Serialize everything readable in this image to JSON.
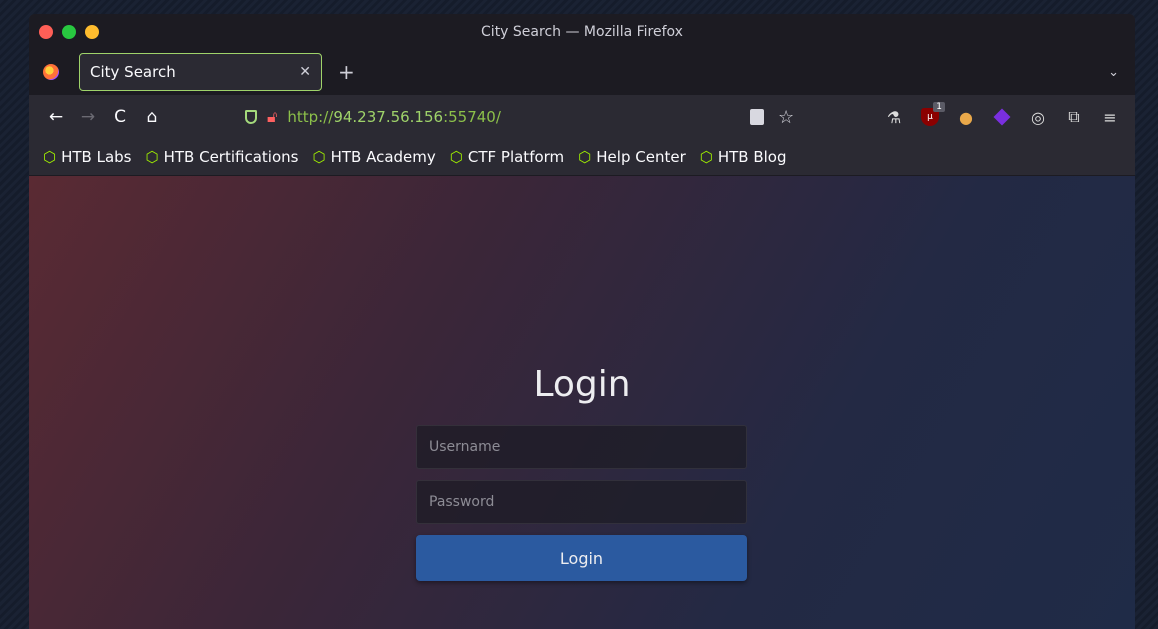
{
  "window": {
    "title": "City Search — Mozilla Firefox"
  },
  "tab": {
    "title": "City Search",
    "close": "✕",
    "new_tab": "+",
    "list_all": "⌄"
  },
  "nav": {
    "back": "←",
    "forward": "→",
    "reload": "C",
    "home": "⌂",
    "url_scheme": "http://",
    "url_host": "94.237.56.156",
    "url_port": ":55740/",
    "bookmark_star": "☆"
  },
  "extensions": {
    "ublock_badge": "1",
    "menu": "≡"
  },
  "bookmarks": [
    {
      "label": "HTB Labs"
    },
    {
      "label": "HTB Certifications"
    },
    {
      "label": "HTB Academy"
    },
    {
      "label": "CTF Platform"
    },
    {
      "label": "Help Center"
    },
    {
      "label": "HTB Blog"
    }
  ],
  "login": {
    "title": "Login",
    "username_placeholder": "Username",
    "password_placeholder": "Password",
    "button": "Login"
  }
}
